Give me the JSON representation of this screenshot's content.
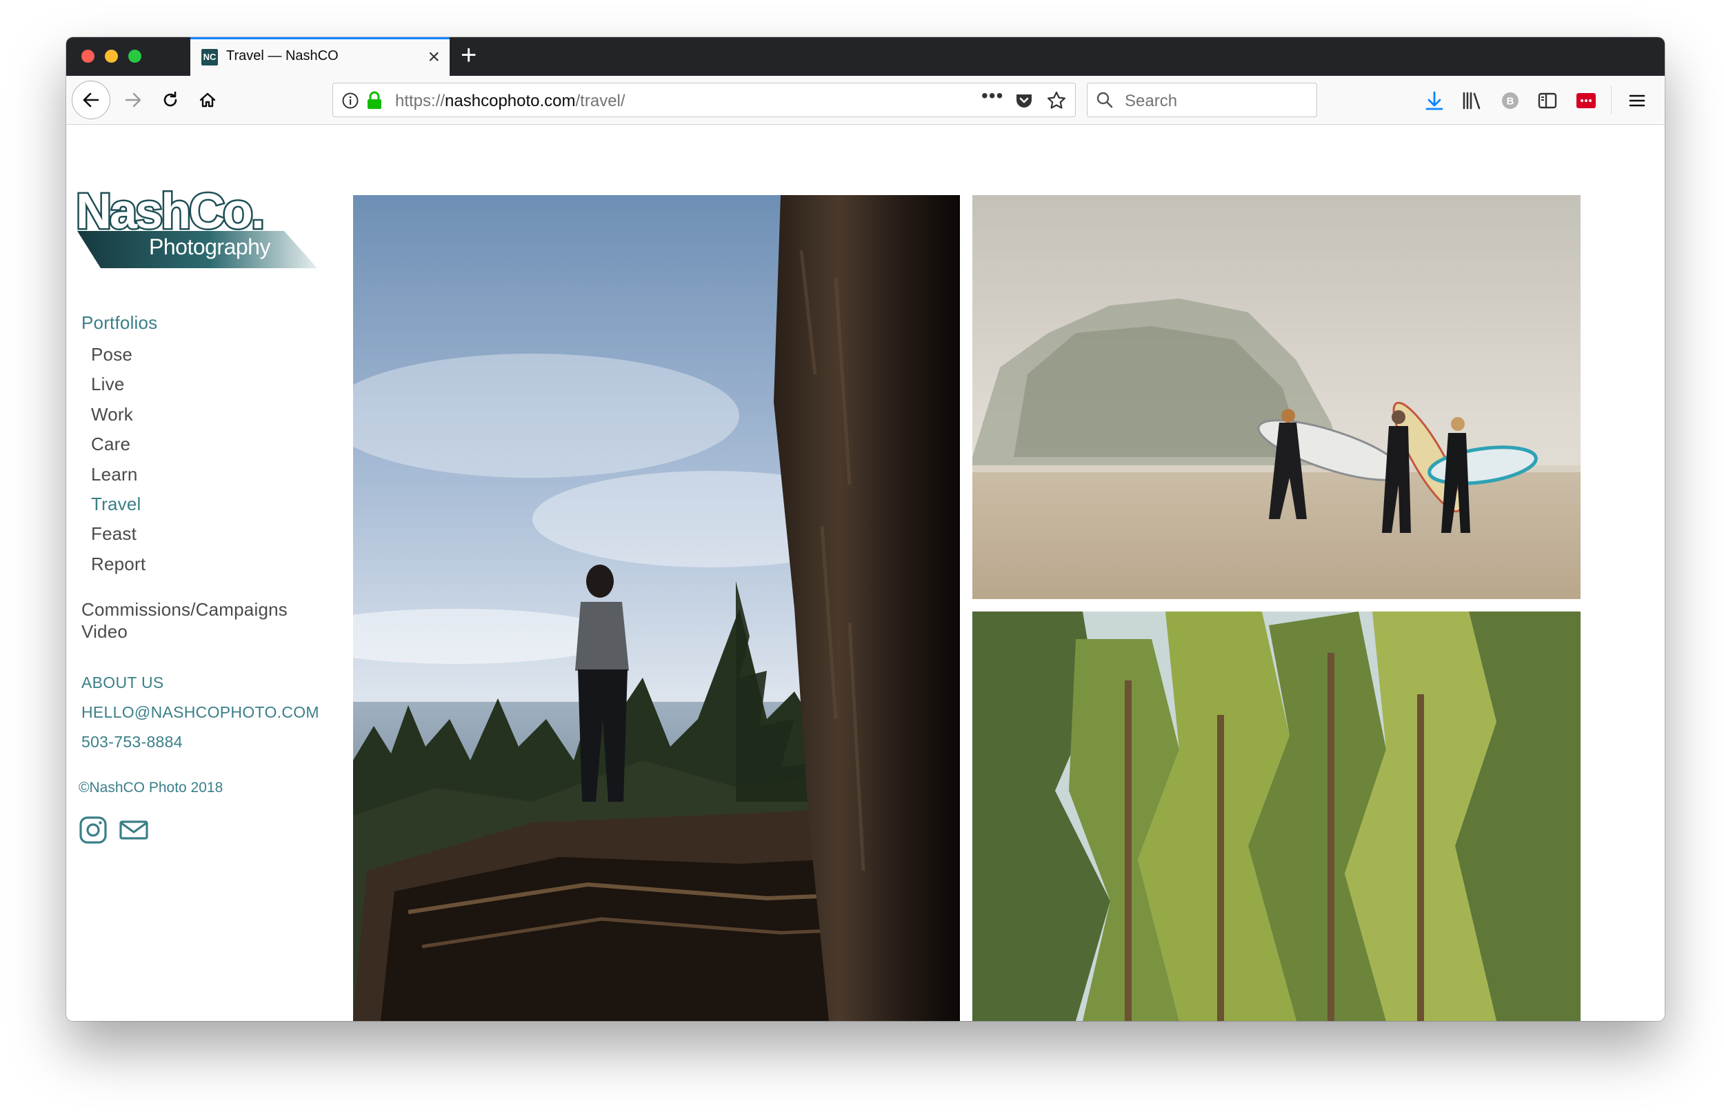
{
  "browser": {
    "tab_title": "Travel — NashCO",
    "tab_favicon": "NC",
    "url_prefix": "https://",
    "url_host": "nashcophoto.com",
    "url_path": "/travel/",
    "search_placeholder": "Search",
    "icons": [
      "back-icon",
      "forward-icon",
      "reload-icon",
      "home-icon",
      "info-icon",
      "lock-icon",
      "more-icon",
      "pocket-icon",
      "star-icon",
      "search-icon",
      "download-icon",
      "library-icon",
      "extension-icon",
      "sidebar-icon",
      "extension-red-icon",
      "menu-icon"
    ]
  },
  "logo": {
    "line1": "NashCo.",
    "line2": "Photography",
    "color": "#1e4f55"
  },
  "nav": {
    "heading": "Portfolios",
    "portfolios": [
      {
        "label": "Pose"
      },
      {
        "label": "Live"
      },
      {
        "label": "Work"
      },
      {
        "label": "Care"
      },
      {
        "label": "Learn"
      },
      {
        "label": "Travel"
      },
      {
        "label": "Feast"
      },
      {
        "label": "Report"
      }
    ],
    "active": "Travel",
    "commissions": "Commissions/Campaigns",
    "video": "Video",
    "about": "ABOUT US",
    "email": "HELLO@NASHCOPHOTO.COM",
    "phone": "503-753-8884",
    "copyright": "©NashCO Photo 2018",
    "social_icons": [
      "instagram-icon",
      "mail-icon"
    ],
    "accent_color": "#3a7f88"
  }
}
